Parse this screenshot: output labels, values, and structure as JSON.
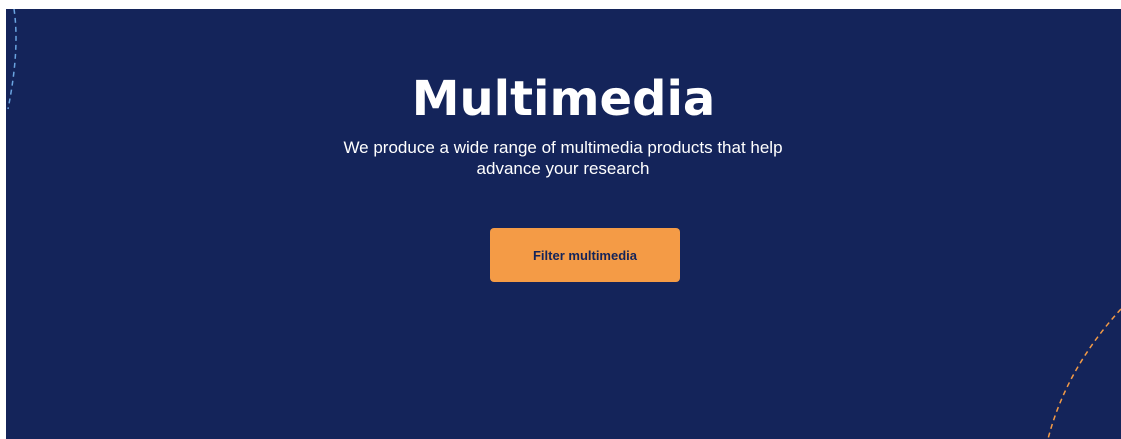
{
  "hero": {
    "title": "Multimedia",
    "subtitle": "We produce a wide range of multimedia products that help advance your research",
    "button_label": "Filter multimedia"
  },
  "colors": {
    "background": "#14245a",
    "button": "#f49b46",
    "button_text": "#14245a",
    "deco_left": "#6aa4e0",
    "deco_right": "#f49b46"
  },
  "icons": {
    "left_decoration": "dashed-arc-icon",
    "right_decoration": "dashed-arc-icon"
  }
}
